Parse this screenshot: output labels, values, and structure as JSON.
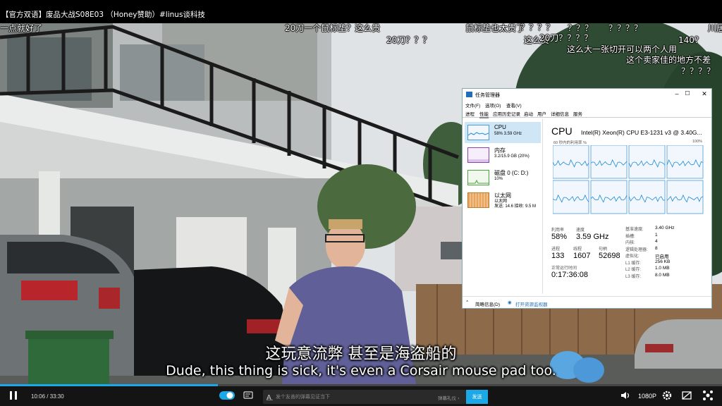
{
  "player": {
    "title": "【官方双语】废品大战S08E03 （Honey赞助）#linus谈科技",
    "time": "10:06 / 33:30",
    "progress": 0.302,
    "danmaku_placeholder": "发个友善的弹幕见证当下",
    "danmaku_etiquette": "弹幕礼仪 ›",
    "send_label": "发送",
    "quality": "1080P",
    "accent_color": "#1aa8e6"
  },
  "danmaku": [
    "一点就好了",
    "20刀一个鼠标垫？这么贵",
    "鼠标垫也太贵了",
    "？？？",
    "川居",
    "20刀？？？",
    "这么贵",
    "140？",
    "？？？？",
    "？？？？",
    "20刀？？？？",
    "这么大一张切开可以两个人用",
    "这个卖家佳的地方不差",
    "？？？？"
  ],
  "subtitles": {
    "cn": "这玩意流弊  甚至是海盗船的",
    "en": "Dude, this thing is sick, it's even a Corsair mouse pad too."
  },
  "task_manager": {
    "title": "任务管理器",
    "menu": [
      "文件(F)",
      "选项(O)",
      "查看(V)"
    ],
    "tabs": [
      "进程",
      "性能",
      "应用历史记录",
      "启动",
      "用户",
      "详细信息",
      "服务"
    ],
    "active_tab": "性能",
    "resources": [
      {
        "name": "CPU",
        "detail": "58% 3.59 GHz",
        "detail2": ""
      },
      {
        "name": "内存",
        "detail": "3.2/15.9 GB (20%)",
        "detail2": ""
      },
      {
        "name": "磁盘 0 (C: D:)",
        "detail": "10%",
        "detail2": ""
      },
      {
        "name": "以太网",
        "detail": "以太网",
        "detail2": "发送: 14.6  接收: 9.5 M"
      }
    ],
    "cpu_heading": "CPU",
    "cpu_model": "Intel(R) Xeon(R) CPU E3-1231 v3 @ 3.40G...",
    "graph_caption": "60 秒内的利用率 %",
    "graph_max": "100%",
    "stats": {
      "utilization_label": "利用率",
      "utilization": "58%",
      "speed_label": "速度",
      "speed": "3.59 GHz",
      "processes_label": "进程",
      "processes": "133",
      "threads_label": "线程",
      "threads": "1607",
      "handles_label": "句柄",
      "handles": "52698",
      "uptime_label": "正常运行时间",
      "uptime": "0:17:36:08"
    },
    "specs": [
      {
        "label": "基准速度:",
        "value": "3.40 GHz"
      },
      {
        "label": "插槽:",
        "value": "1"
      },
      {
        "label": "内核:",
        "value": "4"
      },
      {
        "label": "逻辑处理器:",
        "value": "8"
      },
      {
        "label": "虚拟化:",
        "value": "已启用"
      },
      {
        "label": "L1 缓存:",
        "value": "256 KB"
      },
      {
        "label": "L2 缓存:",
        "value": "1.0 MB"
      },
      {
        "label": "L3 缓存:",
        "value": "8.0 MB"
      }
    ],
    "fewer_details": "简略信息(D)",
    "open_monitor": "打开资源监视器",
    "cpu_graph_color": "#1e8ad6"
  }
}
